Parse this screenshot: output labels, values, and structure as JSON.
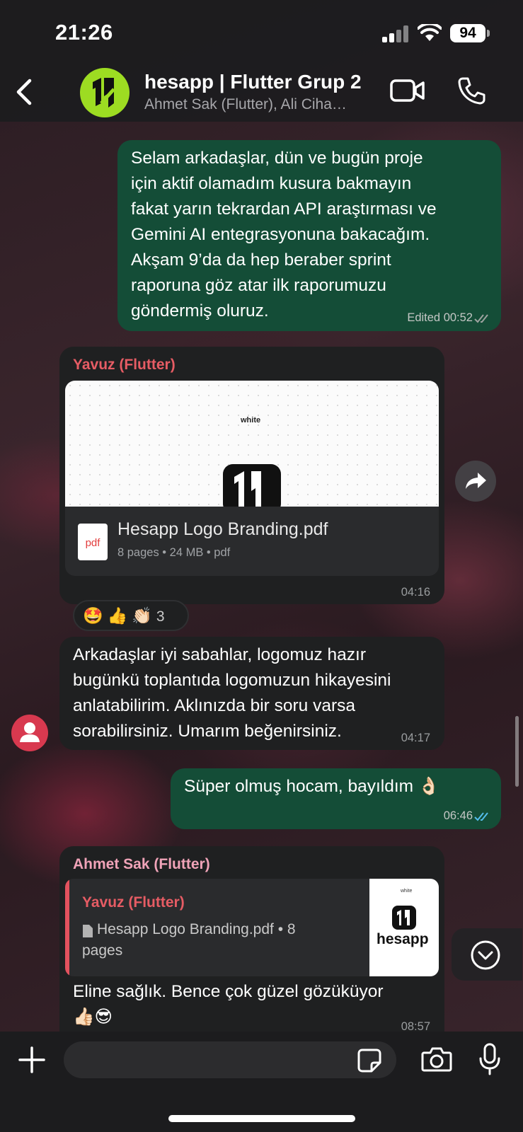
{
  "status_bar": {
    "time": "21:26",
    "battery": "94"
  },
  "header": {
    "title": "hesapp | Flutter Grup 2",
    "subtitle": "Ahmet Sak (Flutter), Ali Ciha…"
  },
  "messages": [
    {
      "direction": "out",
      "lines": [
        "Selam arkadaşlar, dün ve bugün proje",
        "için aktif olamadım kusura bakmayın",
        "fakat yarın tekrardan API araştırması ve",
        "Gemini AI entegrasyonuna bakacağım.",
        "Akşam 9’da da hep beraber sprint",
        "raporuna göz atar ilk raporumuzu",
        "göndermiş oluruz."
      ],
      "meta": "Edited 00:52"
    },
    {
      "direction": "in",
      "sender": "Yavuz (Flutter)",
      "sender_color": "#e65c64",
      "document": {
        "preview_label": "white",
        "icon_label": "pdf",
        "name": "Hesapp Logo Branding.pdf",
        "info": "8 pages • 24 MB • pdf"
      },
      "time": "04:16",
      "reactions": {
        "emojis": [
          "🤩",
          "👍",
          "👏🏻"
        ],
        "count": "3"
      }
    },
    {
      "direction": "in",
      "lines": [
        "Arkadaşlar iyi sabahlar, logomuz hazır",
        "bugünkü toplantıda logomuzun hikayesini",
        "anlatabilirim. Aklınızda bir soru varsa",
        "sorabilirsiniz. Umarım beğenirsiniz."
      ],
      "time": "04:17"
    },
    {
      "direction": "out",
      "text": "Süper olmuş hocam, bayıldım 👌🏻",
      "time": "06:46"
    },
    {
      "direction": "in",
      "sender": "Ahmet Sak (Flutter)",
      "sender_color": "#f0a3b8",
      "quote": {
        "sender": "Yavuz (Flutter)",
        "line1": "Hesapp Logo Branding.pdf • 8",
        "line2": "pages",
        "thumb_label": "hesapp",
        "thumb_small": "white"
      },
      "lines": [
        "Eline sağlık. Bence çok güzel gözüküyor",
        "👍🏻😎"
      ],
      "time": "08:57"
    }
  ],
  "composer": {
    "placeholder": ""
  },
  "colors": {
    "outgoing": "#144d37",
    "incoming": "#1f2021",
    "accent_green": "#9ddc22",
    "read_tick": "#53bdeb"
  }
}
